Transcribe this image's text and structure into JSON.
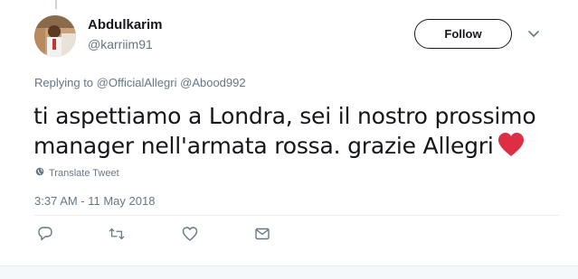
{
  "user": {
    "display_name": "Abdulkarim",
    "screen_name": "@karriim91"
  },
  "follow_button": {
    "label": "Follow"
  },
  "reply_context": {
    "prefix": "Replying to",
    "handles": [
      "@OfficialAllegri",
      "@Abood992"
    ]
  },
  "tweet": {
    "text": "ti aspettiamo a Londra, sei il nostro prossimo manager nell'armata rossa. grazie Allegri",
    "emoji_icon": "red-heart-emoji"
  },
  "translate": {
    "label": "Translate Tweet",
    "icon": "globe-icon"
  },
  "timestamp": "3:37 AM - 11 May 2018",
  "actions": [
    "reply-icon",
    "retweet-icon",
    "like-icon",
    "direct-message-icon"
  ],
  "colors": {
    "secondary_text": "#657786",
    "primary_text": "#14171a",
    "heart": "#e0245e"
  }
}
